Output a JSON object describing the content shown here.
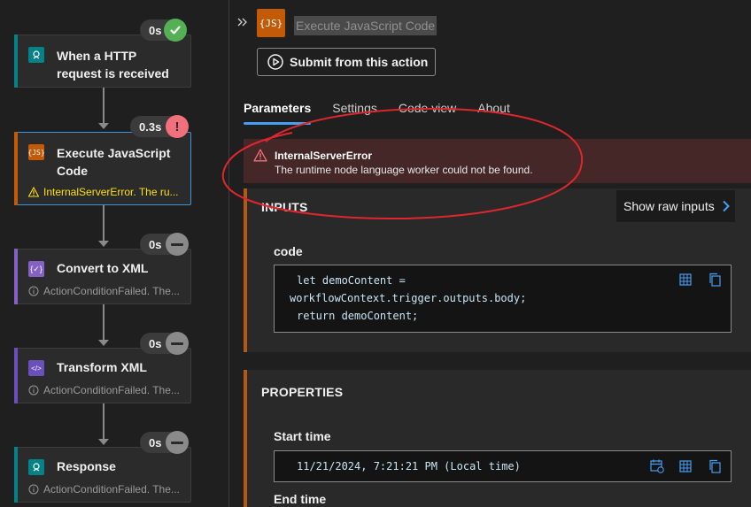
{
  "canvas": {
    "nodes": [
      {
        "title": "When a HTTP request is received",
        "duration": "0s",
        "result": "success",
        "status": "",
        "accent": "#038387",
        "icon": "http-trigger-icon"
      },
      {
        "title": "Execute JavaScript Code",
        "duration": "0.3s",
        "result": "failed",
        "status": "InternalServerError. The ru...",
        "accent": "#c35a07",
        "icon": "javascript-icon"
      },
      {
        "title": "Convert to XML",
        "duration": "0s",
        "result": "skipped",
        "status": "ActionConditionFailed. The...",
        "accent": "#8661c5",
        "icon": "convert-xml-icon"
      },
      {
        "title": "Transform XML",
        "duration": "0s",
        "result": "skipped",
        "status": "ActionConditionFailed. The...",
        "accent": "#6b4fbb",
        "icon": "transform-xml-icon"
      },
      {
        "title": "Response",
        "duration": "0s",
        "result": "skipped",
        "status": "ActionConditionFailed. The...",
        "accent": "#038387",
        "icon": "response-icon"
      }
    ]
  },
  "panel": {
    "title": "Execute JavaScript Code",
    "submit_label": "Submit from this action",
    "tabs": [
      {
        "label": "Parameters",
        "active": true
      },
      {
        "label": "Settings",
        "active": false
      },
      {
        "label": "Code view",
        "active": false
      },
      {
        "label": "About",
        "active": false
      }
    ],
    "error": {
      "title": "InternalServerError",
      "message": "The runtime node language worker could not be found."
    },
    "inputs": {
      "header": "INPUTS",
      "show_raw_label": "Show raw inputs",
      "code_label": "code",
      "code_lines": [
        "let demoContent =",
        "workflowContext.trigger.outputs.body;",
        "return demoContent;"
      ]
    },
    "properties": {
      "header": "PROPERTIES",
      "start_label": "Start time",
      "start_value": "11/21/2024, 7:21:21 PM (Local time)",
      "end_label": "End time"
    }
  },
  "colors": {
    "success": "#54b054",
    "failed": "#f1707b",
    "skipped": "#8a8a8a",
    "warning": "#fce100",
    "link": "#479ef5",
    "annotation": "#e0262d"
  }
}
